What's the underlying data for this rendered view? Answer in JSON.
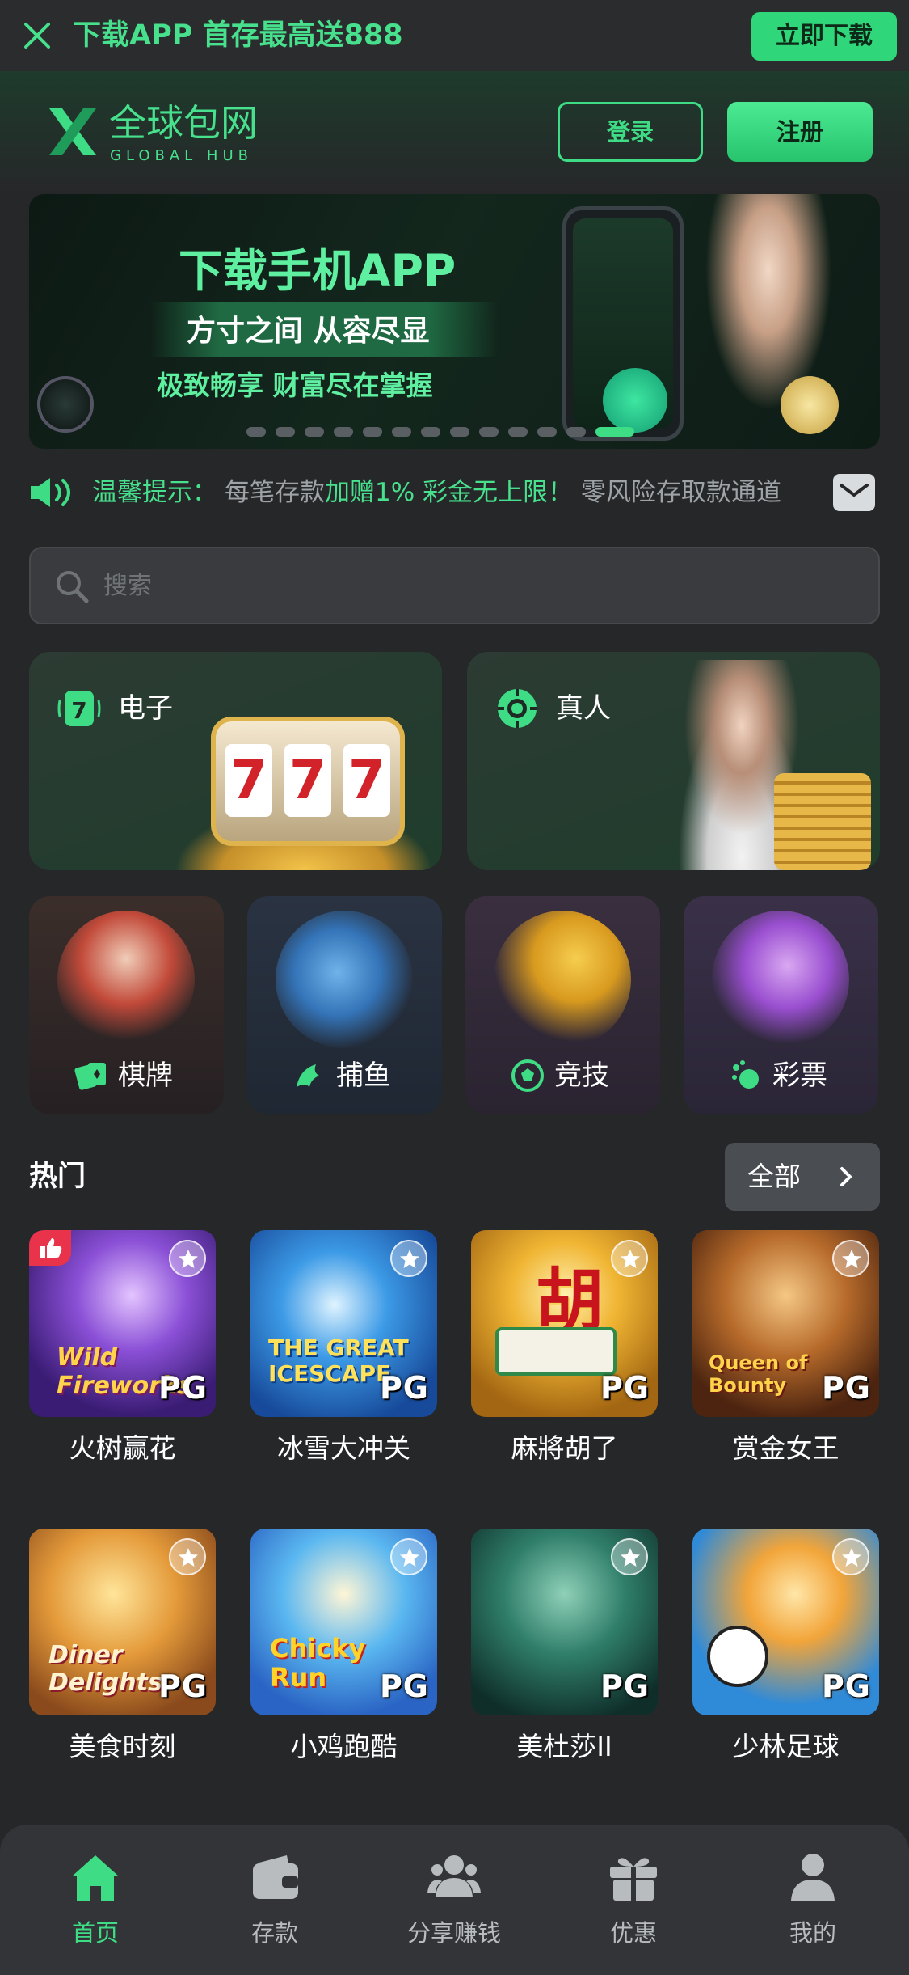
{
  "promo": {
    "text": "下载APP 首存最高送888",
    "button": "立即下载"
  },
  "header": {
    "brand": "全球包网",
    "brand_sub": "GLOBAL HUB",
    "login": "登录",
    "register": "注册"
  },
  "banner": {
    "title": "下载手机APP",
    "subtitle": "方寸之间 从容尽显",
    "tagline": "极致畅享 财富尽在掌握",
    "slides": 13,
    "active_slide": 13
  },
  "notice": {
    "label": "温馨提示：",
    "message_prefix": "每笔存款",
    "message_highlight": "加赠1% 彩金无上限！",
    "message_suffix": " 零风险存取款通道"
  },
  "search": {
    "placeholder": "搜索"
  },
  "categories_big": [
    {
      "label": "电子",
      "icon": "slot-seven-icon"
    },
    {
      "label": "真人",
      "icon": "chip-icon"
    }
  ],
  "categories_small": [
    {
      "label": "棋牌",
      "icon": "cards-icon"
    },
    {
      "label": "捕鱼",
      "icon": "fish-icon"
    },
    {
      "label": "竞技",
      "icon": "soccer-ball-icon"
    },
    {
      "label": "彩票",
      "icon": "lottery-icon"
    }
  ],
  "hot": {
    "title": "热门",
    "all_label": "全部",
    "games": [
      {
        "name": "火树赢花",
        "provider": "PG",
        "art_text": "Wild Fireworks"
      },
      {
        "name": "冰雪大冲关",
        "provider": "PG",
        "art_text": "THE GREAT ICESCAPE"
      },
      {
        "name": "麻將胡了",
        "provider": "PG",
        "art_text": "胡"
      },
      {
        "name": "赏金女王",
        "provider": "PG",
        "art_text": "Queen of Bounty"
      },
      {
        "name": "美食时刻",
        "provider": "PG",
        "art_text": "Diner Delights"
      },
      {
        "name": "小鸡跑酷",
        "provider": "PG",
        "art_text": "Chicky Run"
      },
      {
        "name": "美杜莎II",
        "provider": "PG",
        "art_text": ""
      },
      {
        "name": "少林足球",
        "provider": "PG",
        "art_text": ""
      }
    ]
  },
  "nav": [
    {
      "label": "首页",
      "icon": "home-icon",
      "active": true
    },
    {
      "label": "存款",
      "icon": "wallet-icon",
      "active": false
    },
    {
      "label": "分享赚钱",
      "icon": "users-icon",
      "active": false
    },
    {
      "label": "优惠",
      "icon": "gift-icon",
      "active": false
    },
    {
      "label": "我的",
      "icon": "user-icon",
      "active": false
    }
  ],
  "colors": {
    "accent": "#3fdc86",
    "background": "#262729",
    "card": "#2c3b33"
  }
}
